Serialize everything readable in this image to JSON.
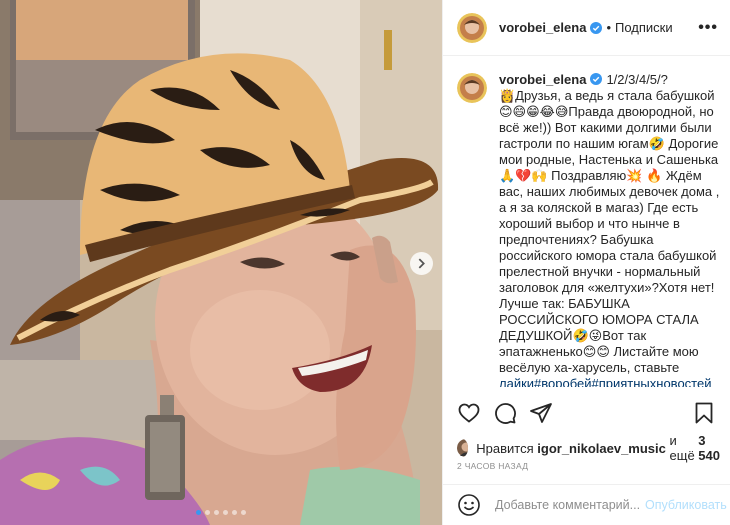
{
  "post": {
    "username": "vorobei_elena",
    "follow_label": "Подписки",
    "separator": "•",
    "more_label": "•••",
    "caption_text": "1/2/3/4/5/?\n👸Друзья, а ведь я стала бабушкой 😊😄😁😂😅Правда двоюродной, но всё же!)) Вот какими долгими были гастроли по нашим югам🤣 Дорогие мои родные, Настенька и Сашенька🙏💔🙌 Поздравляю💥 🔥 Ждём вас, наших любимых девочек дома , а я за коляской в магаз) Где есть хороший выбор и что нынче в предпочтениях? Бабушка российского юмора стала бабушкой прелестной внучки - нормальный заголовок для «желтухи»?Хотя нет! Лучше так: БАБУШКА РОССИЙСКОГО ЮМОРА СТАЛА ДЕДУШКОЙ🤣😜Вот так эпатажненько😊😊 Листайте мою весёлую ха-харусель, ставьте ",
    "caption_tags": "лайки#воробей#приятныхновостей #",
    "likes_prefix": "Нравится",
    "likes_user": "igor_nikolaev_music",
    "likes_and": "и ещё",
    "likes_count": "3 540",
    "time_ago": "2 часов назад",
    "comment_placeholder": "Добавьте комментарий...",
    "publish_label": "Опубликовать"
  },
  "carousel": {
    "slide_count": 6,
    "active_index": 0
  },
  "colors": {
    "accent": "#3897f0",
    "publish_disabled": "#b2dffc",
    "verified": "#3897f0",
    "muted": "#8e8e8e"
  },
  "icons": [
    "verified-badge-icon",
    "heart-icon",
    "comment-icon",
    "share-icon",
    "bookmark-icon",
    "emoji-icon",
    "chevron-right-icon"
  ]
}
